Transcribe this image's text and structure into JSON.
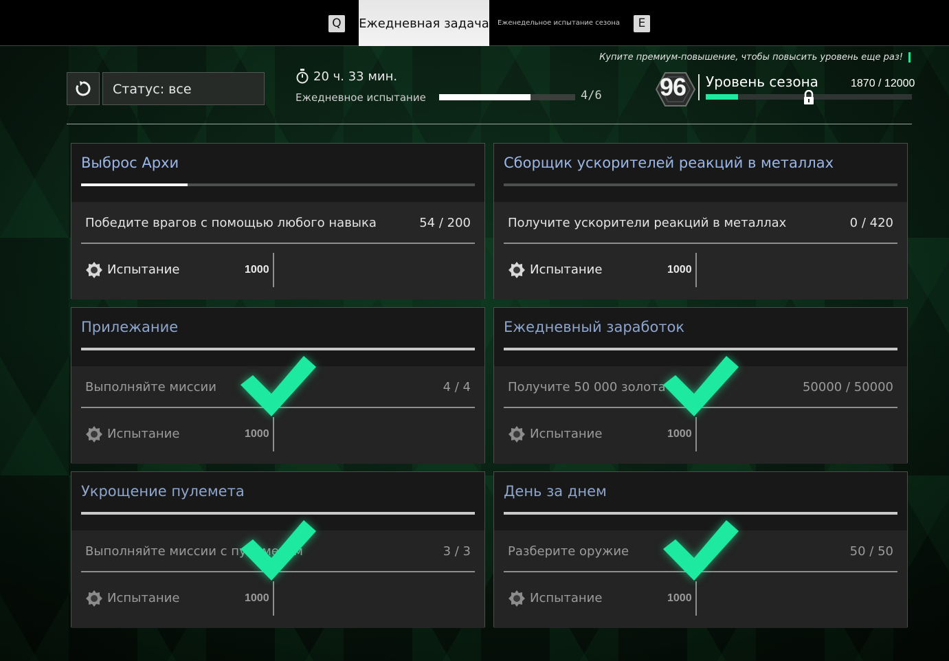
{
  "tabs": {
    "left_key": "Q",
    "active": "Ежедневная задача",
    "weekly": "Еженедельное испытание сезона",
    "right_key": "E"
  },
  "filter": {
    "status_label": "Статус: все"
  },
  "daily": {
    "timer": "20 ч. 33 мин.",
    "label": "Ежедневное испытание",
    "count": "4/6",
    "progress_fraction": 0.67
  },
  "season": {
    "premium_note": "Купите премиум-повышение, чтобы повысить уровень еще раз!",
    "level": "96",
    "label": "Уровень сезона",
    "xp": "1870 / 12000",
    "progress_fraction": 0.156
  },
  "colors": {
    "accent": "#1de9a0",
    "title_blue": "#9bb6e6"
  },
  "cards": [
    {
      "title": "Выброс Архи",
      "title_progress": 0.27,
      "task": "Победите врагов с помощью любого навыка",
      "count": "54 / 200",
      "reward_label": "Испытание",
      "reward_value": "1000",
      "completed": false
    },
    {
      "title": "Сборщик ускорителей реакций в металлах",
      "title_progress": 0,
      "task": "Получите ускорители реакций в металлах",
      "count": "0 / 420",
      "reward_label": "Испытание",
      "reward_value": "1000",
      "completed": false
    },
    {
      "title": "Прилежание",
      "title_progress": 1,
      "task": "Выполняйте миссии",
      "count": "4 / 4",
      "reward_label": "Испытание",
      "reward_value": "1000",
      "completed": true
    },
    {
      "title": "Ежедневный заработок",
      "title_progress": 1,
      "task": "Получите 50 000 золота",
      "count": "50000 / 50000",
      "reward_label": "Испытание",
      "reward_value": "1000",
      "completed": true
    },
    {
      "title": "Укрощение пулемета",
      "title_progress": 1,
      "task": "Выполняйте миссии с пулеметом",
      "count": "3 / 3",
      "reward_label": "Испытание",
      "reward_value": "1000",
      "completed": true
    },
    {
      "title": "День за днем",
      "title_progress": 1,
      "task": "Разберите оружие",
      "count": "50 / 50",
      "reward_label": "Испытание",
      "reward_value": "1000",
      "completed": true
    }
  ]
}
